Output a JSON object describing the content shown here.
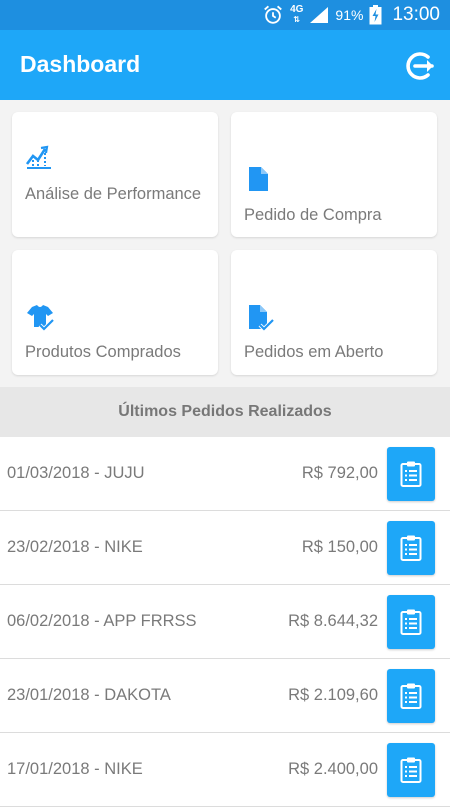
{
  "status_bar": {
    "network": "4G",
    "battery_percent": "91%",
    "time": "13:00",
    "icons": [
      "alarm-icon",
      "signal-icon",
      "battery-charging-icon"
    ]
  },
  "app_bar": {
    "title": "Dashboard",
    "logout_icon": "logout-icon",
    "background": "#1ea7f8"
  },
  "menu_cards": [
    {
      "label": "Análise de Performance",
      "icon": "performance-chart-icon"
    },
    {
      "label": "Pedido de Compra",
      "icon": "document-icon"
    },
    {
      "label": "Produtos Comprados",
      "icon": "shirt-check-icon"
    },
    {
      "label": "Pedidos em Aberto",
      "icon": "document-check-icon"
    }
  ],
  "recent_orders": {
    "header": "Últimos Pedidos Realizados",
    "items": [
      {
        "title": "01/03/2018 - JUJU",
        "value": "R$ 792,00"
      },
      {
        "title": "23/02/2018 - NIKE",
        "value": "R$ 150,00"
      },
      {
        "title": "06/02/2018 - APP FRRSS",
        "value": "R$ 8.644,32"
      },
      {
        "title": "23/01/2018 - DAKOTA",
        "value": "R$ 2.109,60"
      },
      {
        "title": "17/01/2018 - NIKE",
        "value": "R$ 2.400,00"
      }
    ],
    "action_icon": "clipboard-icon"
  },
  "colors": {
    "accent": "#1ea7f8",
    "status_bar": "#1e8fe0",
    "icon_blue": "#2196f3"
  }
}
